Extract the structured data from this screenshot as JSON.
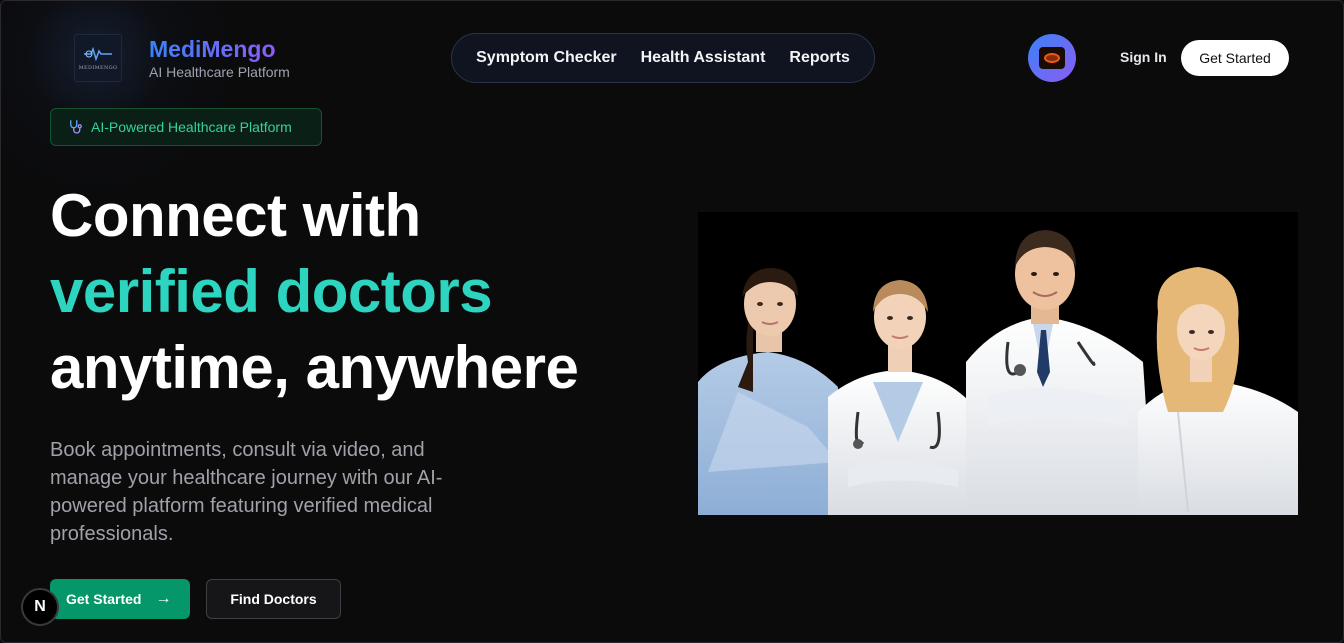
{
  "brand": {
    "name": "MediMengo",
    "tagline": "AI Healthcare Platform",
    "logo_text": "MEDIMENGO"
  },
  "nav": {
    "items": [
      {
        "label": "Symptom Checker"
      },
      {
        "label": "Health Assistant"
      },
      {
        "label": "Reports"
      }
    ]
  },
  "header": {
    "sign_in_label": "Sign In",
    "get_started_label": "Get Started"
  },
  "badge": {
    "icon": "stethoscope-icon",
    "text": "AI-Powered Healthcare Platform"
  },
  "hero": {
    "line1": "Connect with",
    "line2": "verified doctors",
    "line3": "anytime, anywhere",
    "description": "Book appointments, consult via video, and manage your healthcare journey with our AI-powered platform featuring verified medical professionals."
  },
  "actions": {
    "primary_label": "Get Started",
    "primary_icon": "arrow-right-icon",
    "secondary_label": "Find Doctors"
  },
  "dev_badge": {
    "letter": "N"
  },
  "colors": {
    "accent_teal": "#2dd4bf",
    "primary_green": "#059669",
    "brand_gradient_start": "#3b82f6",
    "brand_gradient_end": "#8b5cf6",
    "background": "#0b0b0c"
  }
}
